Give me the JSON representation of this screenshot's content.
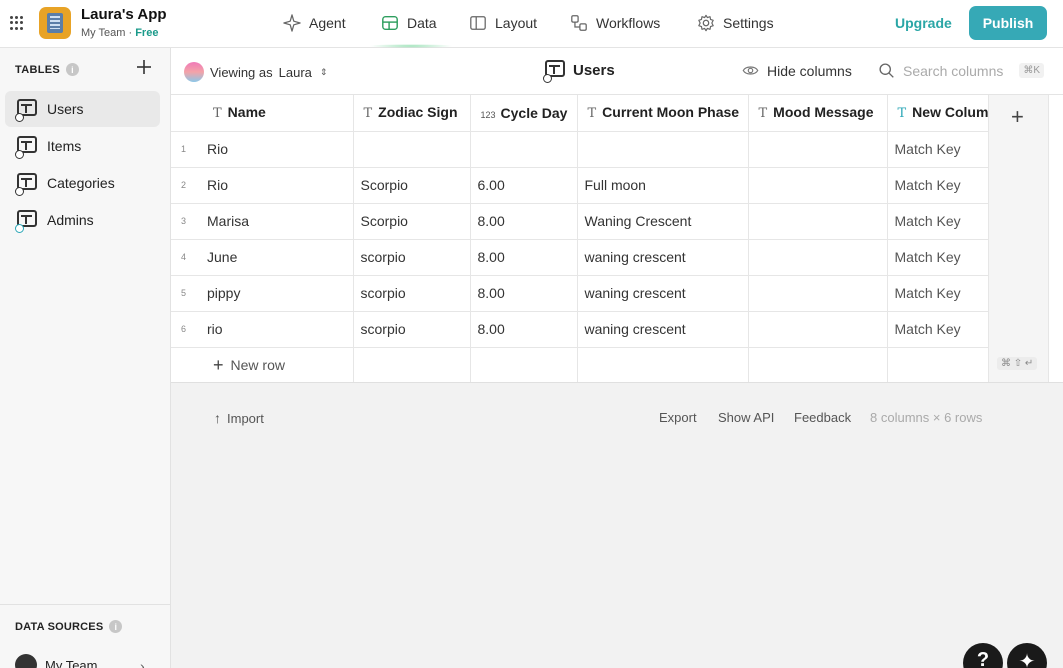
{
  "app": {
    "name": "Laura's App",
    "team": "My Team",
    "plan": "Free",
    "separator": " · "
  },
  "nav": [
    {
      "label": "Agent",
      "icon": "sparkle-icon"
    },
    {
      "label": "Data",
      "icon": "table-icon",
      "active": true
    },
    {
      "label": "Layout",
      "icon": "layout-icon"
    },
    {
      "label": "Workflows",
      "icon": "workflow-icon"
    },
    {
      "label": "Settings",
      "icon": "gear-icon"
    }
  ],
  "header": {
    "upgrade": "Upgrade",
    "publish": "Publish"
  },
  "sidebar": {
    "tables_heading": "TABLES",
    "items": [
      {
        "label": "Users",
        "active": true
      },
      {
        "label": "Items"
      },
      {
        "label": "Categories"
      },
      {
        "label": "Admins"
      }
    ],
    "data_sources_heading": "DATA SOURCES",
    "data_source_team": "My Team"
  },
  "toolbar": {
    "viewing_prefix": "Viewing as",
    "viewing_user": "Laura",
    "table_title": "Users",
    "hide_columns": "Hide columns",
    "search_placeholder": "Search columns",
    "search_shortcut": "⌘K"
  },
  "table": {
    "columns": [
      {
        "label": "Name",
        "type_icon": "T"
      },
      {
        "label": "Zodiac Sign",
        "type_icon": "T"
      },
      {
        "label": "Cycle Day",
        "type_icon": "123"
      },
      {
        "label": "Current Moon Phase",
        "type_icon": "T"
      },
      {
        "label": "Mood Message",
        "type_icon": "T"
      },
      {
        "label": "New Column",
        "type_icon": "T"
      }
    ],
    "rows": [
      {
        "n": "1",
        "name": "Rio",
        "zodiac": "",
        "cycle": "",
        "moon": "",
        "mood": "",
        "newcol": "Match Key"
      },
      {
        "n": "2",
        "name": "Rio",
        "zodiac": "Scorpio",
        "cycle": "6.00",
        "moon": "Full moon",
        "mood": "",
        "newcol": "Match Key"
      },
      {
        "n": "3",
        "name": "Marisa",
        "zodiac": "Scorpio",
        "cycle": "8.00",
        "moon": "Waning Crescent",
        "mood": "",
        "newcol": "Match Key"
      },
      {
        "n": "4",
        "name": "June",
        "zodiac": "scorpio",
        "cycle": "8.00",
        "moon": "waning crescent",
        "mood": "",
        "newcol": "Match Key"
      },
      {
        "n": "5",
        "name": "pippy",
        "zodiac": "scorpio",
        "cycle": "8.00",
        "moon": "waning crescent",
        "mood": "",
        "newcol": "Match Key"
      },
      {
        "n": "6",
        "name": "rio",
        "zodiac": "scorpio",
        "cycle": "8.00",
        "moon": "waning crescent",
        "mood": "",
        "newcol": "Match Key"
      }
    ],
    "new_row_label": "New row",
    "add_row_shortcut": "⌘ ⇧ ↵"
  },
  "footer": {
    "import": "Import",
    "export": "Export",
    "show_api": "Show API",
    "feedback": "Feedback",
    "summary": "8 columns × 6 rows"
  },
  "fabs": {
    "help": "?",
    "assistant": "✦"
  }
}
